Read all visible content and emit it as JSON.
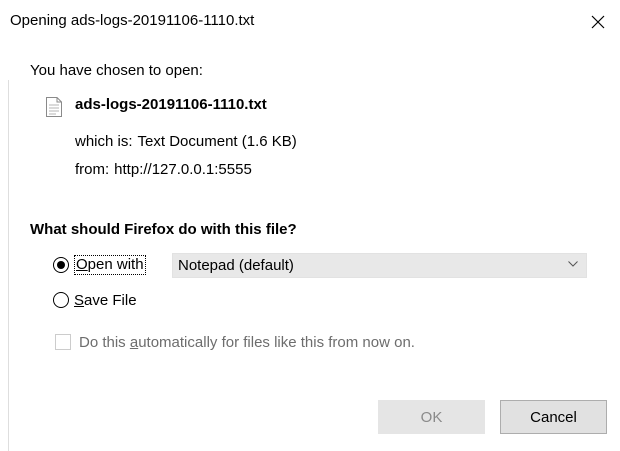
{
  "window": {
    "title": "Opening ads-logs-20191106-1110.txt"
  },
  "content": {
    "chosen_label": "You have chosen to open:",
    "file_name": "ads-logs-20191106-1110.txt",
    "type_label": "which is:",
    "type_value": "Text Document (1.6 KB)",
    "from_label": "from:",
    "from_value": "http://127.0.0.1:5555"
  },
  "action": {
    "question": "What should Firefox do with this file?",
    "open_with": {
      "label_prefix": "",
      "accesskey": "O",
      "label_rest": "pen with",
      "selected": true,
      "app_value": "Notepad (default)"
    },
    "save_file": {
      "accesskey": "S",
      "label_rest": "ave File",
      "selected": false
    },
    "auto": {
      "prefix": "Do this ",
      "accesskey": "a",
      "rest": "utomatically for files like this from now on.",
      "checked": false,
      "enabled": false
    }
  },
  "buttons": {
    "ok": "OK",
    "cancel": "Cancel"
  },
  "icons": {
    "close": "close-icon",
    "file": "text-file-icon",
    "dropdown": "chevron-down-icon"
  }
}
